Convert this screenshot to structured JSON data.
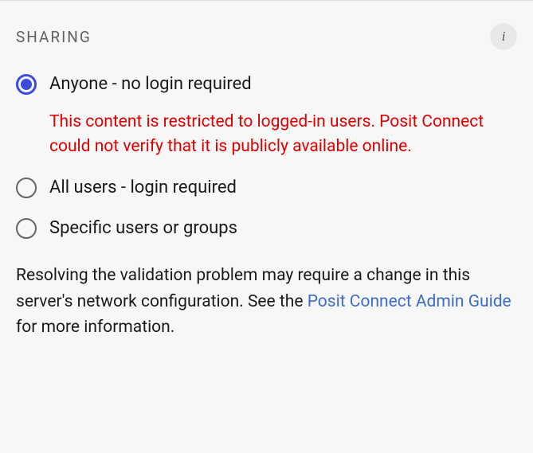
{
  "section": {
    "title": "SHARING"
  },
  "options": {
    "anyone": {
      "label": "Anyone - no login required",
      "warning": "This content is restricted to logged-in users. Posit Connect could not verify that it is publicly available online."
    },
    "allUsers": {
      "label": "All users - login required"
    },
    "specific": {
      "label": "Specific users or groups"
    }
  },
  "footer": {
    "textBefore": "Resolving the validation problem may require a change in this server's network configuration. See the ",
    "linkText": "Posit Connect Admin Guide",
    "textAfter": " for more information."
  }
}
